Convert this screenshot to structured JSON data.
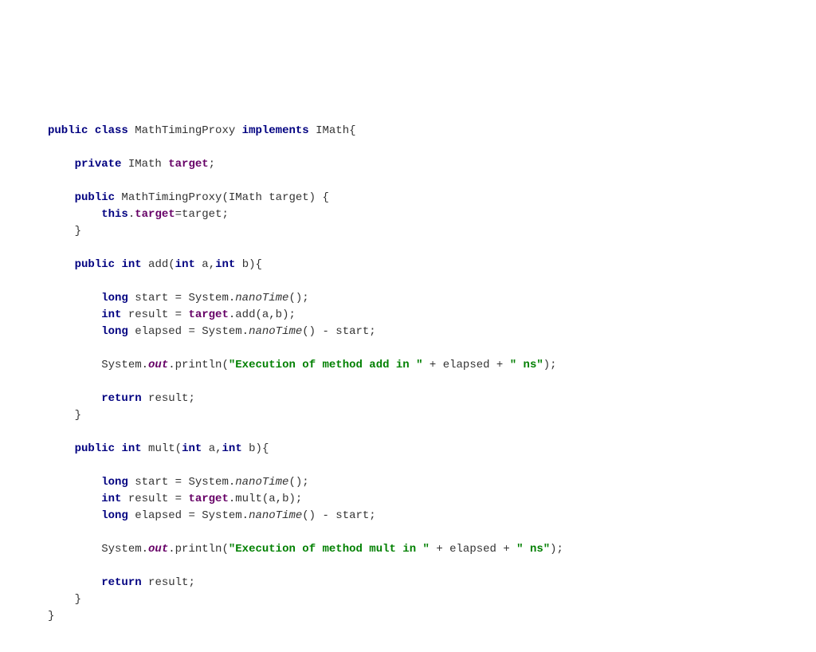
{
  "tokens": [
    {
      "t": "public",
      "c": "kw"
    },
    {
      "t": " ",
      "c": "plain"
    },
    {
      "t": "class",
      "c": "kw"
    },
    {
      "t": " MathTimingProxy ",
      "c": "plain"
    },
    {
      "t": "implements",
      "c": "kw"
    },
    {
      "t": " IMath{",
      "c": "plain"
    },
    {
      "t": "\n\n",
      "c": "plain"
    },
    {
      "t": "    ",
      "c": "plain"
    },
    {
      "t": "private",
      "c": "kw"
    },
    {
      "t": " IMath ",
      "c": "plain"
    },
    {
      "t": "target",
      "c": "field"
    },
    {
      "t": ";",
      "c": "plain"
    },
    {
      "t": "\n\n",
      "c": "plain"
    },
    {
      "t": "    ",
      "c": "plain"
    },
    {
      "t": "public",
      "c": "kw"
    },
    {
      "t": " MathTimingProxy(IMath target) {",
      "c": "plain"
    },
    {
      "t": "\n",
      "c": "plain"
    },
    {
      "t": "        ",
      "c": "plain"
    },
    {
      "t": "this",
      "c": "kw"
    },
    {
      "t": ".",
      "c": "plain"
    },
    {
      "t": "target",
      "c": "field"
    },
    {
      "t": "=target;",
      "c": "plain"
    },
    {
      "t": "\n",
      "c": "plain"
    },
    {
      "t": "    }",
      "c": "plain"
    },
    {
      "t": "\n\n",
      "c": "plain"
    },
    {
      "t": "    ",
      "c": "plain"
    },
    {
      "t": "public",
      "c": "kw"
    },
    {
      "t": " ",
      "c": "plain"
    },
    {
      "t": "int",
      "c": "kw"
    },
    {
      "t": " add(",
      "c": "plain"
    },
    {
      "t": "int",
      "c": "kw"
    },
    {
      "t": " a,",
      "c": "plain"
    },
    {
      "t": "int",
      "c": "kw"
    },
    {
      "t": " b){",
      "c": "plain"
    },
    {
      "t": "\n\n",
      "c": "plain"
    },
    {
      "t": "        ",
      "c": "plain"
    },
    {
      "t": "long",
      "c": "kw"
    },
    {
      "t": " start = System.",
      "c": "plain"
    },
    {
      "t": "nanoTime",
      "c": "staticm"
    },
    {
      "t": "();",
      "c": "plain"
    },
    {
      "t": "\n",
      "c": "plain"
    },
    {
      "t": "        ",
      "c": "plain"
    },
    {
      "t": "int",
      "c": "kw"
    },
    {
      "t": " result = ",
      "c": "plain"
    },
    {
      "t": "target",
      "c": "field"
    },
    {
      "t": ".add(a,b);",
      "c": "plain"
    },
    {
      "t": "\n",
      "c": "plain"
    },
    {
      "t": "        ",
      "c": "plain"
    },
    {
      "t": "long",
      "c": "kw"
    },
    {
      "t": " elapsed = System.",
      "c": "plain"
    },
    {
      "t": "nanoTime",
      "c": "staticm"
    },
    {
      "t": "() - start;",
      "c": "plain"
    },
    {
      "t": "\n\n",
      "c": "plain"
    },
    {
      "t": "        System.",
      "c": "plain"
    },
    {
      "t": "out",
      "c": "static"
    },
    {
      "t": ".println(",
      "c": "plain"
    },
    {
      "t": "\"Execution of method add in \"",
      "c": "str"
    },
    {
      "t": " + elapsed + ",
      "c": "plain"
    },
    {
      "t": "\" ns\"",
      "c": "str"
    },
    {
      "t": ");",
      "c": "plain"
    },
    {
      "t": "\n\n",
      "c": "plain"
    },
    {
      "t": "        ",
      "c": "plain"
    },
    {
      "t": "return",
      "c": "kw"
    },
    {
      "t": " result;",
      "c": "plain"
    },
    {
      "t": "\n",
      "c": "plain"
    },
    {
      "t": "    }",
      "c": "plain"
    },
    {
      "t": "\n\n",
      "c": "plain"
    },
    {
      "t": "    ",
      "c": "plain"
    },
    {
      "t": "public",
      "c": "kw"
    },
    {
      "t": " ",
      "c": "plain"
    },
    {
      "t": "int",
      "c": "kw"
    },
    {
      "t": " mult(",
      "c": "plain"
    },
    {
      "t": "int",
      "c": "kw"
    },
    {
      "t": " a,",
      "c": "plain"
    },
    {
      "t": "int",
      "c": "kw"
    },
    {
      "t": " b){",
      "c": "plain"
    },
    {
      "t": "\n\n",
      "c": "plain"
    },
    {
      "t": "        ",
      "c": "plain"
    },
    {
      "t": "long",
      "c": "kw"
    },
    {
      "t": " start = System.",
      "c": "plain"
    },
    {
      "t": "nanoTime",
      "c": "staticm"
    },
    {
      "t": "();",
      "c": "plain"
    },
    {
      "t": "\n",
      "c": "plain"
    },
    {
      "t": "        ",
      "c": "plain"
    },
    {
      "t": "int",
      "c": "kw"
    },
    {
      "t": " result = ",
      "c": "plain"
    },
    {
      "t": "target",
      "c": "field"
    },
    {
      "t": ".mult(a,b);",
      "c": "plain"
    },
    {
      "t": "\n",
      "c": "plain"
    },
    {
      "t": "        ",
      "c": "plain"
    },
    {
      "t": "long",
      "c": "kw"
    },
    {
      "t": " elapsed = System.",
      "c": "plain"
    },
    {
      "t": "nanoTime",
      "c": "staticm"
    },
    {
      "t": "() - start;",
      "c": "plain"
    },
    {
      "t": "\n\n",
      "c": "plain"
    },
    {
      "t": "        System.",
      "c": "plain"
    },
    {
      "t": "out",
      "c": "static"
    },
    {
      "t": ".println(",
      "c": "plain"
    },
    {
      "t": "\"Execution of method mult in \"",
      "c": "str"
    },
    {
      "t": " + elapsed + ",
      "c": "plain"
    },
    {
      "t": "\" ns\"",
      "c": "str"
    },
    {
      "t": ");",
      "c": "plain"
    },
    {
      "t": "\n\n",
      "c": "plain"
    },
    {
      "t": "        ",
      "c": "plain"
    },
    {
      "t": "return",
      "c": "kw"
    },
    {
      "t": " result;",
      "c": "plain"
    },
    {
      "t": "\n",
      "c": "plain"
    },
    {
      "t": "    }",
      "c": "plain"
    },
    {
      "t": "\n",
      "c": "plain"
    },
    {
      "t": "}",
      "c": "plain"
    }
  ]
}
